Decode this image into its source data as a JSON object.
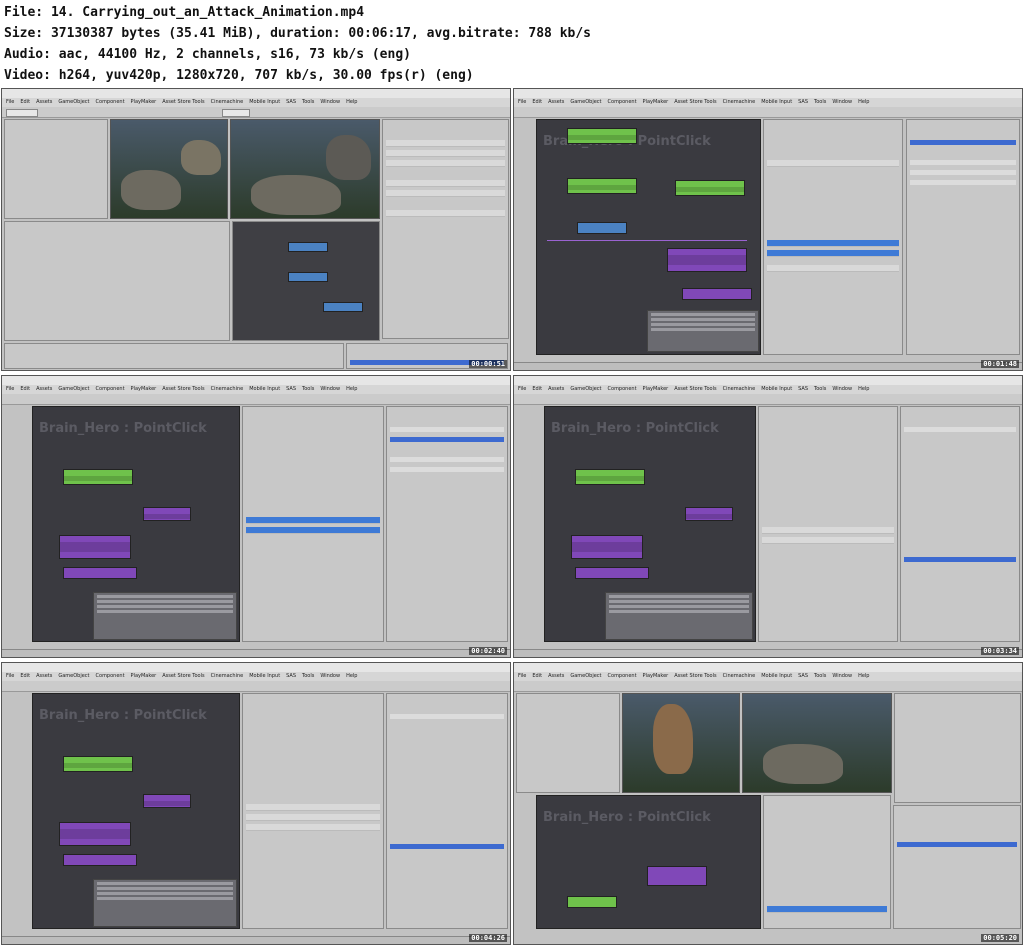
{
  "header": {
    "file_line": "File: 14. Carrying_out_an_Attack_Animation.mp4",
    "size_line": "Size: 37130387 bytes (35.41 MiB), duration: 00:06:17, avg.bitrate: 788 kb/s",
    "audio_line": "Audio: aac, 44100 Hz, 2 channels, s16, 73 kb/s (eng)",
    "video_line": "Video: h264, yuv420p, 1280x720, 707 kb/s, 30.00 fps(r) (eng)"
  },
  "app": {
    "menu": [
      "File",
      "Edit",
      "Assets",
      "GameObject",
      "Component",
      "PlayMaker",
      "Asset Store Tools",
      "Cinemachine",
      "Mobile Input",
      "SAS",
      "Tools",
      "Window",
      "Help"
    ]
  },
  "fsm_title": "Brain_Hero : PointClick",
  "frames": [
    {
      "timestamp": "00:00:51",
      "layout": "editor"
    },
    {
      "timestamp": "00:01:48",
      "layout": "fsm"
    },
    {
      "timestamp": "00:02:40",
      "layout": "fsm"
    },
    {
      "timestamp": "00:03:34",
      "layout": "fsm"
    },
    {
      "timestamp": "00:04:26",
      "layout": "fsm"
    },
    {
      "timestamp": "00:05:20",
      "layout": "editor-fsm"
    }
  ]
}
